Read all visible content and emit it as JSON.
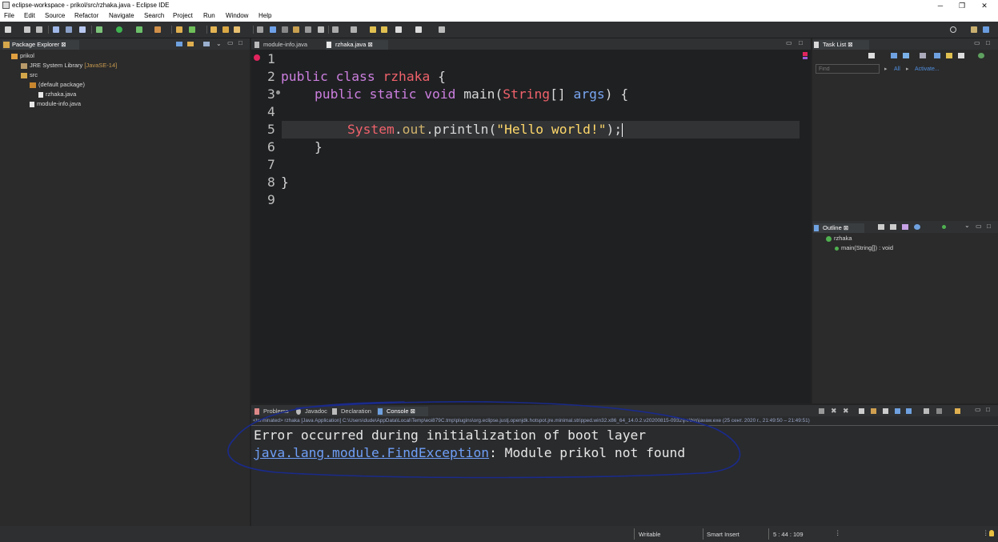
{
  "window": {
    "title": "eclipse-workspace - prikol/src/rzhaka.java - Eclipse IDE",
    "minimize": "─",
    "restore": "❐",
    "close": "✕"
  },
  "menu": [
    "File",
    "Edit",
    "Source",
    "Refactor",
    "Navigate",
    "Search",
    "Project",
    "Run",
    "Window",
    "Help"
  ],
  "package_explorer": {
    "tab_label": "Package Explorer",
    "project": "prikol",
    "jre": "JRE System Library",
    "jre_version": "[JavaSE-14]",
    "src": "src",
    "default_package": "(default package)",
    "file1": "rzhaka.java",
    "file2": "module-info.java"
  },
  "editor": {
    "tabs": [
      "module-info.java",
      "rzhaka.java"
    ],
    "line_numbers": [
      "1",
      "2",
      "3",
      "4",
      "5",
      "6",
      "7",
      "8",
      "9"
    ]
  },
  "code": {
    "l2_kw": "public class ",
    "l2_cls": "rzhaka",
    "l2_rest": " {",
    "l3_kw": "public static void ",
    "l3_m": "main(",
    "l3_type": "String",
    "l3_br": "[] ",
    "l3_par": "args",
    "l3_rest": ") {",
    "l5_cls": "System",
    "l5_dot": ".",
    "l5_fld": "out",
    "l5_m": ".println(",
    "l5_str": "\"Hello world!\"",
    "l5_end": ");",
    "l6": "}",
    "l8": "}"
  },
  "task_list": {
    "tab_label": "Task List",
    "find_placeholder": "Find",
    "all": "All",
    "activate": "Activate..."
  },
  "outline": {
    "tab_label": "Outline",
    "class": "rzhaka",
    "method": "main(String[]) : void"
  },
  "bottom_tabs": [
    "Problems",
    "Javadoc",
    "Declaration",
    "Console"
  ],
  "console": {
    "terminated": "<terminated> rzhaka [Java Application] C:\\Users\\dude\\AppData\\Local\\Temp\\eoi879C.tmp\\plugins\\org.eclipse.justj.openjdk.hotspot.jre.minimal.stripped.win32.x86_64_14.0.2.v20200815-0932\\jre\\bin\\javaw.exe  (25 сент. 2020 г., 21:49:50 – 21:49:51)",
    "line1": "Error occurred during initialization of boot layer",
    "line2_link": "java.lang.module.FindException",
    "line2_rest": ": Module prikol not found"
  },
  "status": {
    "writable": "Writable",
    "insert_mode": "Smart Insert",
    "position": "5 : 44 : 109"
  },
  "colors": {
    "annotation_circle": "#1a2a8a",
    "error_marker": "#e0245e",
    "link": "#6f9ff7"
  }
}
